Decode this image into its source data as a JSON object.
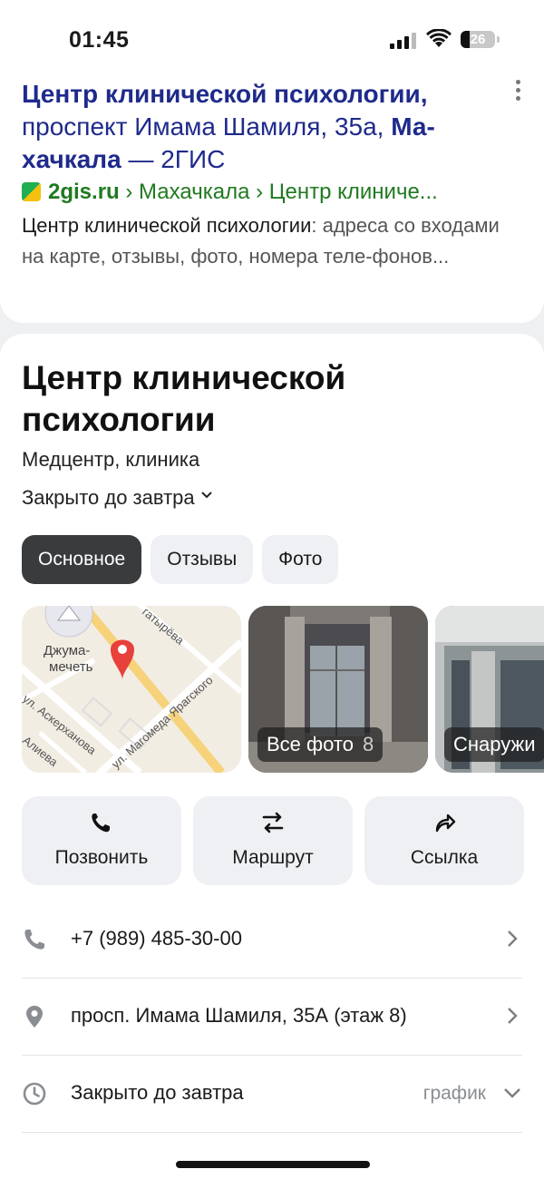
{
  "status_bar": {
    "time": "01:45",
    "battery": "26",
    "battery_level": 0.26
  },
  "snippet": {
    "title_part1": "Центр клинической психологии,",
    "title_part2": "проспект Имама Шамиля, 35а,",
    "title_part3": "Ма-",
    "title_part4": "хачкала",
    "title_part5": "— 2ГИС",
    "domain": "2gis.ru",
    "breadcrumb": "› Махачкала › Центр клиниче...",
    "desc_bold": "Центр клинической психологии",
    "desc_rest": ": адреса со входами на карте, отзывы, фото, номера теле-фонов..."
  },
  "org": {
    "name": "Центр клинической психологии",
    "type": "Медцентр, клиника",
    "hours": "Закрыто до завтра"
  },
  "tabs": [
    {
      "label": "Основное",
      "active": true
    },
    {
      "label": "Отзывы",
      "active": false
    },
    {
      "label": "Фото",
      "active": false
    }
  ],
  "map": {
    "labels": [
      "Джума-",
      "мечеть",
      "ул. Аскерханова",
      "Алиева",
      "ул. Магомеда Ярагского",
      "гатырёва"
    ]
  },
  "photos": [
    {
      "label": "Все фото",
      "count": "8"
    },
    {
      "label": "Снаружи",
      "count": ""
    }
  ],
  "actions": [
    {
      "label": "Позвонить",
      "icon": "phone-icon"
    },
    {
      "label": "Маршрут",
      "icon": "route-icon"
    },
    {
      "label": "Ссылка",
      "icon": "share-icon"
    }
  ],
  "info_rows": [
    {
      "text": "+7 (989) 485-30-00",
      "icon": "phone-icon",
      "extra": ""
    },
    {
      "text": "просп. Имама Шамиля, 35А (этаж 8)",
      "icon": "location-pin-icon",
      "extra": ""
    },
    {
      "text": "Закрыто до завтра",
      "icon": "clock-icon",
      "extra": "график"
    }
  ],
  "colors": {
    "title_link": "#1f2a8c",
    "url_green": "#1f7a1f",
    "active_tab": "#3a3b3d",
    "pin_red": "#e8403a"
  }
}
